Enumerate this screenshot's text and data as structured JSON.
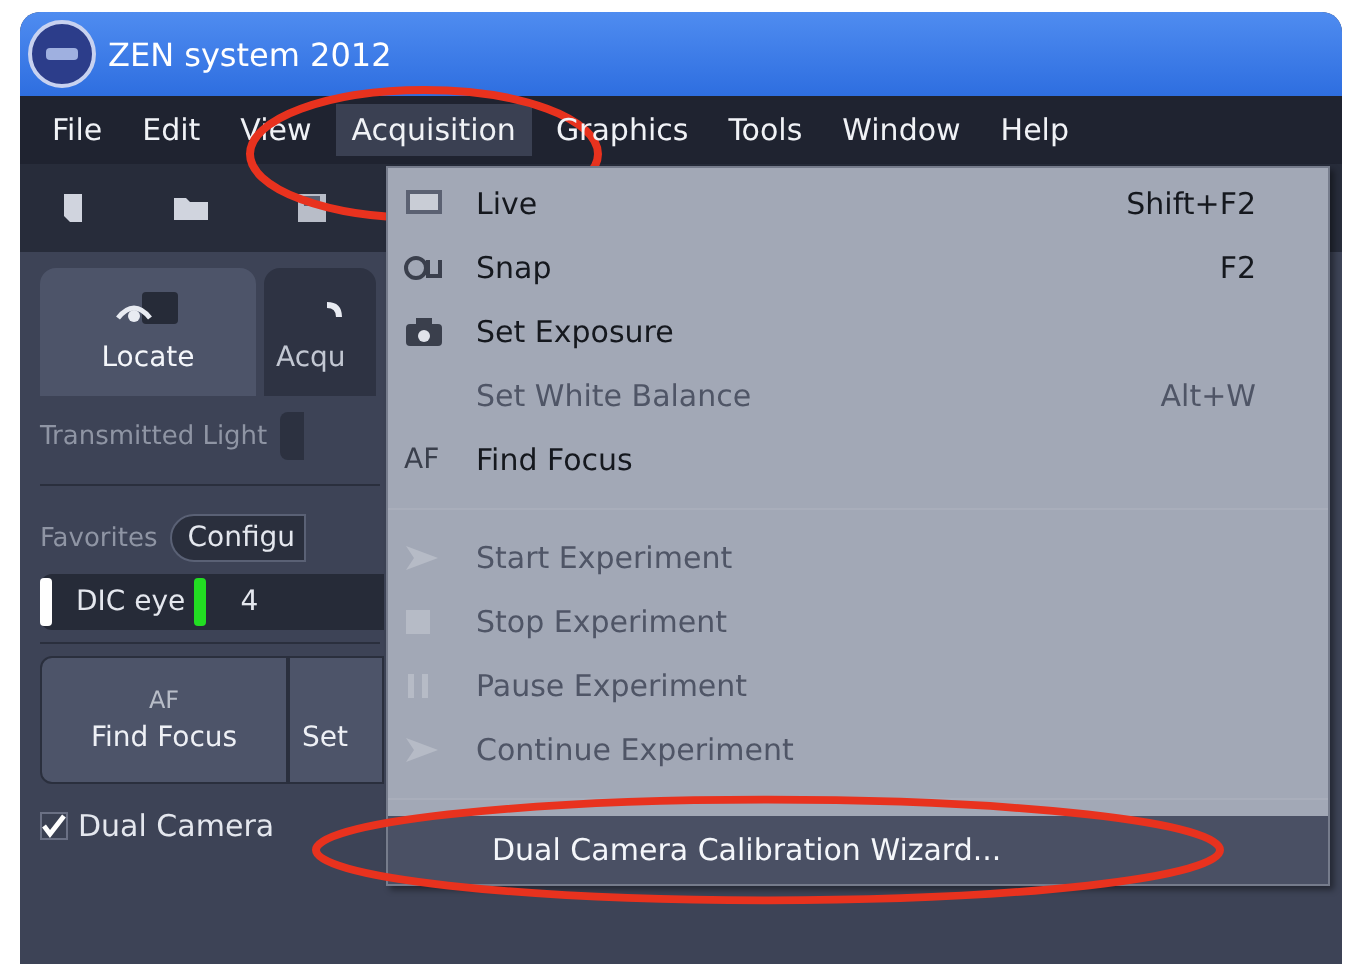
{
  "window": {
    "title": "ZEN system 2012"
  },
  "menu_bar": [
    {
      "label": "File",
      "selected": false,
      "circled": false
    },
    {
      "label": "Edit",
      "selected": false,
      "circled": false
    },
    {
      "label": "View",
      "selected": false,
      "circled": false
    },
    {
      "label": "Acquisition",
      "selected": true,
      "circled": true
    },
    {
      "label": "Graphics",
      "selected": false,
      "circled": false
    },
    {
      "label": "Tools",
      "selected": false,
      "circled": false
    },
    {
      "label": "Window",
      "selected": false,
      "circled": false
    },
    {
      "label": "Help",
      "selected": false,
      "circled": false
    }
  ],
  "left_tabs": [
    {
      "label": "Locate",
      "selected": true
    },
    {
      "label": "Acqu",
      "selected": false
    }
  ],
  "light_path": {
    "label": "Transmitted Light"
  },
  "favorites": {
    "label": "Favorites",
    "button": "Configu"
  },
  "channels": [
    {
      "label": "DIC eye",
      "color": "#ffffff"
    },
    {
      "label": "4",
      "color": "#22dd22"
    }
  ],
  "actions": [
    {
      "icon_text": "AF",
      "label": "Find Focus"
    },
    {
      "label": "Set"
    }
  ],
  "dual_camera": {
    "label": "Dual Camera",
    "checked": true
  },
  "menu": [
    {
      "kind": "live",
      "label": "Live",
      "shortcut": "Shift+F2",
      "disabled": false,
      "selected": false,
      "circled": false
    },
    {
      "kind": "snap",
      "label": "Snap",
      "shortcut": "F2",
      "disabled": false,
      "selected": false,
      "circled": false
    },
    {
      "kind": "camera",
      "label": "Set Exposure",
      "disabled": false,
      "selected": false,
      "circled": false
    },
    {
      "kind": "plain",
      "label": "Set White Balance",
      "shortcut": "Alt+W",
      "disabled": true,
      "selected": false,
      "circled": false
    },
    {
      "kind": "lettered",
      "icon_text": "AF",
      "label": "Find Focus",
      "disabled": false,
      "selected": false,
      "circled": false
    },
    {
      "kind": "separator"
    },
    {
      "kind": "play",
      "label": "Start Experiment",
      "disabled": true,
      "selected": false,
      "circled": false
    },
    {
      "kind": "stop",
      "label": "Stop Experiment",
      "disabled": true,
      "selected": false,
      "circled": false
    },
    {
      "kind": "pause",
      "label": "Pause Experiment",
      "disabled": true,
      "selected": false,
      "circled": false
    },
    {
      "kind": "play",
      "label": "Continue Experiment",
      "disabled": true,
      "selected": false,
      "circled": false
    },
    {
      "kind": "separator"
    },
    {
      "kind": "plain",
      "label": "Dual Camera Calibration Wizard...",
      "disabled": false,
      "selected": true,
      "circled": true
    }
  ]
}
